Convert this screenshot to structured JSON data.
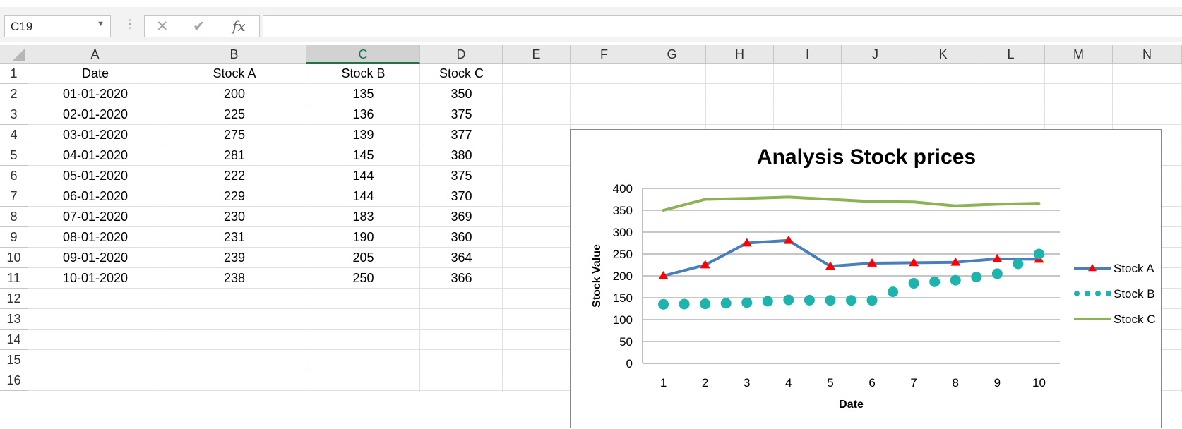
{
  "formula_bar": {
    "name_box": "C19",
    "formula": ""
  },
  "columns": [
    "A",
    "B",
    "C",
    "D",
    "E",
    "F",
    "G",
    "H",
    "I",
    "J",
    "K",
    "L",
    "M",
    "N"
  ],
  "selected_column": "C",
  "rows": [
    "1",
    "2",
    "3",
    "4",
    "5",
    "6",
    "7",
    "8",
    "9",
    "10",
    "11",
    "12",
    "13",
    "14",
    "15",
    "16"
  ],
  "table": {
    "headers": [
      "Date",
      "Stock A",
      "Stock B",
      "Stock C"
    ],
    "rows": [
      [
        "01-01-2020",
        "200",
        "135",
        "350"
      ],
      [
        "02-01-2020",
        "225",
        "136",
        "375"
      ],
      [
        "03-01-2020",
        "275",
        "139",
        "377"
      ],
      [
        "04-01-2020",
        "281",
        "145",
        "380"
      ],
      [
        "05-01-2020",
        "222",
        "144",
        "375"
      ],
      [
        "06-01-2020",
        "229",
        "144",
        "370"
      ],
      [
        "07-01-2020",
        "230",
        "183",
        "369"
      ],
      [
        "08-01-2020",
        "231",
        "190",
        "360"
      ],
      [
        "09-01-2020",
        "239",
        "205",
        "364"
      ],
      [
        "10-01-2020",
        "238",
        "250",
        "366"
      ]
    ]
  },
  "chart_data": {
    "type": "line",
    "title": "Analysis Stock prices",
    "xlabel": "Date",
    "ylabel": "Stock Value",
    "ylim": [
      0,
      400
    ],
    "yticks": [
      "0",
      "50",
      "100",
      "150",
      "200",
      "250",
      "300",
      "350",
      "400"
    ],
    "categories": [
      "1",
      "2",
      "3",
      "4",
      "5",
      "6",
      "7",
      "8",
      "9",
      "10"
    ],
    "grid": true,
    "legend_position": "right",
    "series": [
      {
        "name": "Stock A",
        "values": [
          200,
          225,
          275,
          281,
          222,
          229,
          230,
          231,
          239,
          238
        ],
        "color": "#4a7ebb",
        "marker": "triangle",
        "marker_color": "#ff0000",
        "style": "line"
      },
      {
        "name": "Stock B",
        "values": [
          135,
          136,
          139,
          145,
          144,
          144,
          183,
          190,
          205,
          250
        ],
        "color": "#1fb3ad",
        "marker": "circle",
        "style": "dots"
      },
      {
        "name": "Stock C",
        "values": [
          350,
          375,
          377,
          380,
          375,
          370,
          369,
          360,
          364,
          366
        ],
        "color": "#8db255",
        "marker": "none",
        "style": "line"
      }
    ]
  }
}
